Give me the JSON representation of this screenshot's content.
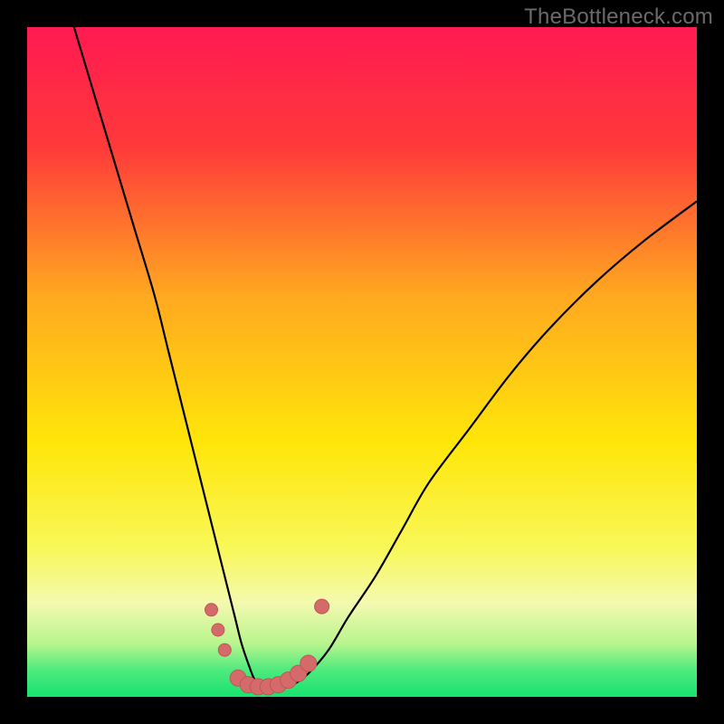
{
  "watermark": "TheBottleneck.com",
  "chart_data": {
    "type": "line",
    "title": "",
    "xlabel": "",
    "ylabel": "",
    "xlim": [
      0,
      100
    ],
    "ylim": [
      0,
      100
    ],
    "background_gradient": [
      {
        "stop": 0.0,
        "color": "#ff1a52"
      },
      {
        "stop": 0.18,
        "color": "#ff3a3a"
      },
      {
        "stop": 0.4,
        "color": "#ffa820"
      },
      {
        "stop": 0.62,
        "color": "#ffe609"
      },
      {
        "stop": 0.78,
        "color": "#f8f85a"
      },
      {
        "stop": 0.86,
        "color": "#f4f9b0"
      },
      {
        "stop": 0.92,
        "color": "#b9f58e"
      },
      {
        "stop": 0.96,
        "color": "#4eea7e"
      },
      {
        "stop": 1.0,
        "color": "#17e36d"
      }
    ],
    "series": [
      {
        "name": "bottleneck-curve",
        "stroke": "#000000",
        "x": [
          7,
          10,
          13,
          16,
          19,
          21,
          23,
          25,
          26.5,
          28,
          29.5,
          31,
          32,
          33,
          34,
          35,
          36.5,
          38,
          40,
          42,
          45,
          48,
          52,
          56,
          60,
          66,
          72,
          78,
          85,
          92,
          100
        ],
        "y": [
          100,
          90,
          80,
          70,
          60,
          52,
          44,
          36,
          30,
          24,
          18,
          12,
          8,
          5,
          2.5,
          1.8,
          1.5,
          1.6,
          2,
          3.5,
          7,
          12,
          18,
          25,
          32,
          40,
          48,
          55,
          62,
          68,
          74
        ]
      }
    ],
    "markers": {
      "name": "highlight-points",
      "color": "#d46a6a",
      "stroke": "#c05656",
      "points": [
        {
          "x": 27.5,
          "y": 13.0,
          "r": 7
        },
        {
          "x": 28.5,
          "y": 10.0,
          "r": 7
        },
        {
          "x": 29.5,
          "y": 7.0,
          "r": 7
        },
        {
          "x": 31.5,
          "y": 2.8,
          "r": 9
        },
        {
          "x": 33.0,
          "y": 1.8,
          "r": 9
        },
        {
          "x": 34.5,
          "y": 1.5,
          "r": 9
        },
        {
          "x": 36.0,
          "y": 1.5,
          "r": 9
        },
        {
          "x": 37.5,
          "y": 1.8,
          "r": 9
        },
        {
          "x": 39.0,
          "y": 2.5,
          "r": 9
        },
        {
          "x": 40.5,
          "y": 3.5,
          "r": 9
        },
        {
          "x": 42.0,
          "y": 5.0,
          "r": 9
        },
        {
          "x": 44.0,
          "y": 13.5,
          "r": 8
        }
      ]
    }
  }
}
